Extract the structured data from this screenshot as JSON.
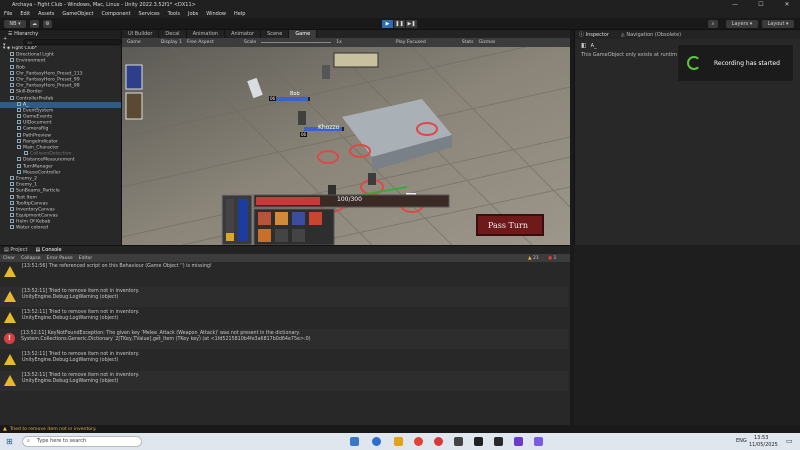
{
  "window": {
    "title": "Archaya - Fight Club - Windows, Mac, Linux - Unity 2022.3.52f1* <DX11>",
    "min": "—",
    "max": "☐",
    "close": "✕"
  },
  "menu": [
    "File",
    "Edit",
    "Assets",
    "GameObject",
    "Component",
    "Services",
    "Tools",
    "Jobs",
    "Window",
    "Help"
  ],
  "toolbar": {
    "account": "NB ▾",
    "layers": "Layers",
    "layout": "Layout"
  },
  "hierarchy": {
    "tab": "Hierarchy",
    "search_placeholder": "All",
    "root": "Fight Club*",
    "items": [
      {
        "label": "Directional Light",
        "indent": 1
      },
      {
        "label": "Environment",
        "indent": 1
      },
      {
        "label": "Bob",
        "indent": 1
      },
      {
        "label": "Chr_FantasyHero_Preset_113",
        "indent": 1
      },
      {
        "label": "Chr_FantasyHero_Preset_99",
        "indent": 1
      },
      {
        "label": "Chr_FantasyHero_Preset_98",
        "indent": 1
      },
      {
        "label": "Skill-Border",
        "indent": 1
      },
      {
        "label": "ControllerPrefab",
        "indent": 1
      },
      {
        "label": "A_",
        "indent": 2,
        "selected": true
      },
      {
        "label": "EventSystem",
        "indent": 2
      },
      {
        "label": "GameEvents",
        "indent": 2
      },
      {
        "label": "UIDocument",
        "indent": 2
      },
      {
        "label": "CameraRig",
        "indent": 2
      },
      {
        "label": "PathPreview",
        "indent": 2
      },
      {
        "label": "RangeIndicator",
        "indent": 2
      },
      {
        "label": "Main_Character",
        "indent": 2
      },
      {
        "label": "CollisionDetection",
        "indent": 3,
        "dim": true
      },
      {
        "label": "DistanceMeasurement",
        "indent": 2
      },
      {
        "label": "TurnManager",
        "indent": 2
      },
      {
        "label": "MouseController",
        "indent": 2
      },
      {
        "label": "Enemy_2",
        "indent": 1
      },
      {
        "label": "Enemy_1",
        "indent": 1
      },
      {
        "label": "SunBeams_Particle",
        "indent": 1
      },
      {
        "label": "Test Item",
        "indent": 1
      },
      {
        "label": "TooltipCanvas",
        "indent": 1
      },
      {
        "label": "InventoryCanvas",
        "indent": 1
      },
      {
        "label": "EquipmentCanvas",
        "indent": 1
      },
      {
        "label": "Helm Of Kebab",
        "indent": 1
      },
      {
        "label": "Water colored",
        "indent": 1
      }
    ]
  },
  "scene_tabs": [
    "UI Builder",
    "Decal",
    "Animation",
    "Animator",
    "Scene",
    "Game"
  ],
  "game_toolbar": {
    "mode": "Game",
    "display": "Display 1",
    "aspect": "Free Aspect",
    "scale_label": "Scale",
    "scale_value": "1x",
    "play_focused": "Play Focused",
    "stats": "Stats",
    "gizmos": "Gizmos"
  },
  "game": {
    "unit1_name": "Bob",
    "unit1_level": "06",
    "unit2_name": "Khozzo",
    "unit2_level": "06",
    "health_text": "100/300",
    "pass_turn": "Pass Turn",
    "initiative_level": "06"
  },
  "inspector": {
    "tab1": "Inspector",
    "tab2": "Navigation (Obsolete)",
    "object_name": "A_",
    "message": "This GameObject only exists at runtime"
  },
  "toast": {
    "text": "Recording has started"
  },
  "console": {
    "tabs": [
      "Project",
      "Console"
    ],
    "toolbar": [
      "Clear",
      "Collapse",
      "Error Pause",
      "Editor"
    ],
    "warn_count": "21",
    "err_count": "1",
    "entries": [
      {
        "type": "warn",
        "line1": "[13:51:56] The referenced script on this Behaviour (Game Object '') is missing!",
        "line2": ""
      },
      {
        "type": "warn",
        "line1": "[13:52:11] Tried to remove item not in inventory.",
        "line2": "UnityEngine.Debug:LogWarning (object)"
      },
      {
        "type": "warn",
        "line1": "[13:52:11] Tried to remove item not in inventory.",
        "line2": "UnityEngine.Debug:LogWarning (object)"
      },
      {
        "type": "error",
        "line1": "[13:52:11] KeyNotFoundException: The given key 'Melee_Attack (Weapon_Attack)' was not present in the dictionary.",
        "line2": "System.Collections.Generic.Dictionary`2[TKey,TValue].get_Item (TKey key) (at <1fd5215810b4fe3a6817b0d64e75e>:0)"
      },
      {
        "type": "warn",
        "line1": "[13:52:11] Tried to remove item not in inventory.",
        "line2": "UnityEngine.Debug:LogWarning (object)"
      },
      {
        "type": "warn",
        "line1": "[13:52:11] Tried to remove item not in inventory.",
        "line2": "UnityEngine.Debug:LogWarning (object)"
      }
    ]
  },
  "status": "Tried to remove item not in inventory.",
  "taskbar": {
    "search_placeholder": "Type here to search",
    "lang": "ENG",
    "time": "13:53",
    "date": "11/05/2025"
  }
}
